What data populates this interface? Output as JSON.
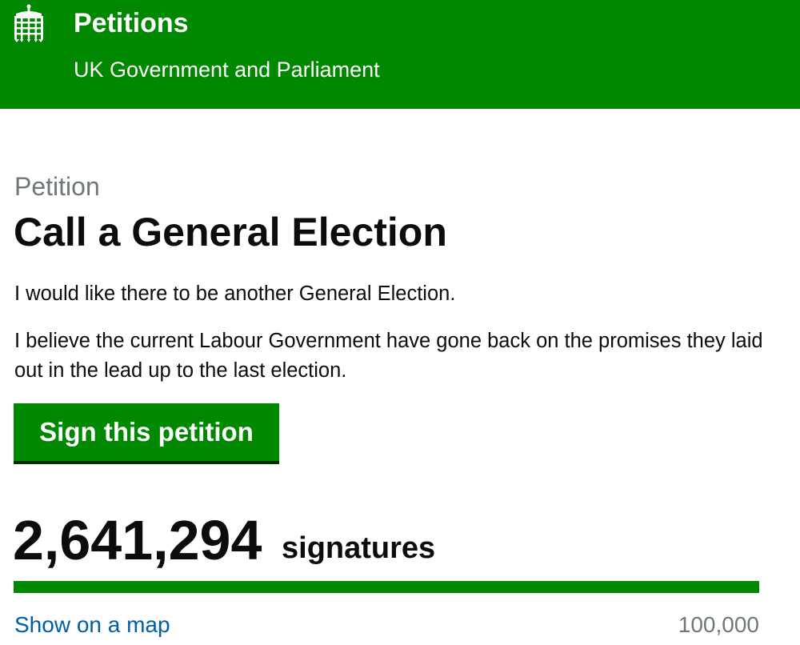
{
  "header": {
    "site_title": "Petitions",
    "site_subtitle": "UK Government and Parliament",
    "logo_icon": "portcullis-icon"
  },
  "petition": {
    "caption": "Petition",
    "title": "Call a General Election",
    "paragraphs": [
      "I would like there to be another General Election.",
      "I believe the current Labour Government have gone back on the promises they laid out in the lead up to the last election."
    ],
    "sign_label": "Sign this petition"
  },
  "signatures": {
    "count": "2,641,294",
    "label": "signatures",
    "progress_fraction": 1.0,
    "map_link": "Show on a map",
    "threshold": "100,000"
  },
  "colors": {
    "brand_green": "#008800",
    "link_blue": "#005ea5",
    "secondary_text": "#6f777b"
  }
}
